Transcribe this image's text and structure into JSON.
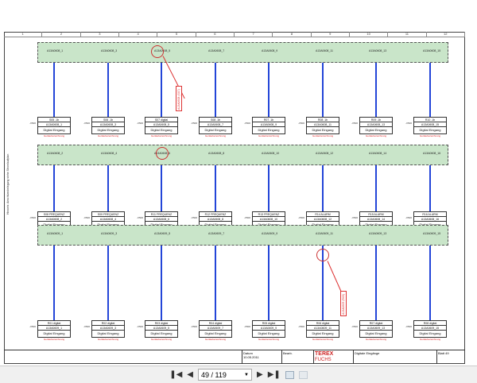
{
  "ruler": [
    "1",
    "2",
    "3",
    "4",
    "5",
    "6",
    "7",
    "8",
    "9",
    "10",
    "11",
    "12"
  ],
  "bands": [
    {
      "labels": [
        "A13A0608_1",
        "A13A0608_3",
        "A13A0608_5",
        "A13A0608_7",
        "A13A0608_9",
        "A13A0608_11",
        "A13A0608_13",
        "A13A0608_15"
      ]
    },
    {
      "labels": [
        "A13A0608_2",
        "A13A0608_4",
        "A13A0608_6",
        "A13A0608_8",
        "A13A0608_10",
        "A13A0608_12",
        "A13A0608_14",
        "A13A0608_16"
      ]
    },
    {
      "labels": [
        "A13A0609_1",
        "A13A0609_3",
        "A13A0609_5",
        "A13A0609_7",
        "A13A0609_9",
        "A13A0609_11",
        "A13A0609_13",
        "A13A0609_15"
      ]
    }
  ],
  "rows": [
    {
      "titles": [
        "S05 .1b",
        "S06 .1b",
        "S07 digital",
        "S08 .1b",
        "R07 .1b",
        "R08 .1b",
        "R09 .1b",
        "R10 .1b"
      ],
      "type": "Digital Eingang"
    },
    {
      "titles": [
        "S08 FREQUENZ",
        "S09 FREQUENZ",
        "R11 FREQUENZ",
        "R12 FREQUENZ",
        "R13 FREQUENZ",
        "R14 ALARM",
        "R15 ALARM",
        "R16 ALARM"
      ],
      "type": "Digital Eingang"
    },
    {
      "titles": [
        "R01 digital",
        "R02 digital",
        "R03 digital",
        "R04 digital",
        "R05 digital",
        "R06 digital",
        "R07 digital",
        "R08 digital"
      ],
      "type": "Digital Eingang"
    }
  ],
  "red_note": "Gerätebezeichnung",
  "side_note": "-X500",
  "annotations": [
    "A13A0608 (S07)",
    "A13A0609 (R05)"
  ],
  "left_note": "Hinweis: Anschlussbelegung siehe Stromlaufplan",
  "titleblock": {
    "brand": "TEREX",
    "sub": "FUCHS",
    "date": "Datum",
    "date_val": "10.05.2011",
    "name": "Bearb.",
    "desc": "Digitale Eingänge",
    "page": "Blatt 49"
  },
  "toolbar": {
    "page": "49 / 119"
  }
}
